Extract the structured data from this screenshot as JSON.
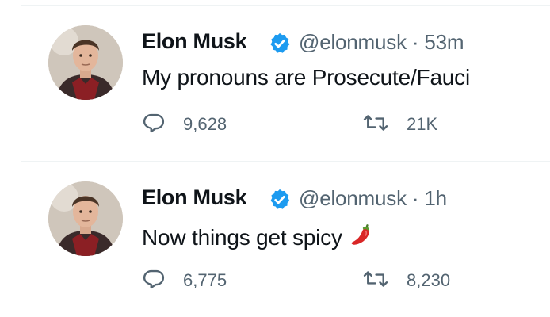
{
  "tweets": [
    {
      "name": "Elon Musk",
      "handle": "@elonmusk",
      "separator": "·",
      "time": "53m",
      "text": "My pronouns are Prosecute/Fauci",
      "emoji": "",
      "replies": "9,628",
      "retweets": "21K"
    },
    {
      "name": "Elon Musk",
      "handle": "@elonmusk",
      "separator": "·",
      "time": "1h",
      "text": "Now things get spicy",
      "emoji": "chili-pepper",
      "replies": "6,775",
      "retweets": "8,230"
    }
  ],
  "colors": {
    "verified": "#1d9bf0",
    "text_primary": "#0f1419",
    "text_secondary": "#536471",
    "divider": "#eff3f4"
  },
  "icons": [
    "verified-badge-icon",
    "reply-icon",
    "retweet-icon",
    "chili-pepper-icon"
  ]
}
